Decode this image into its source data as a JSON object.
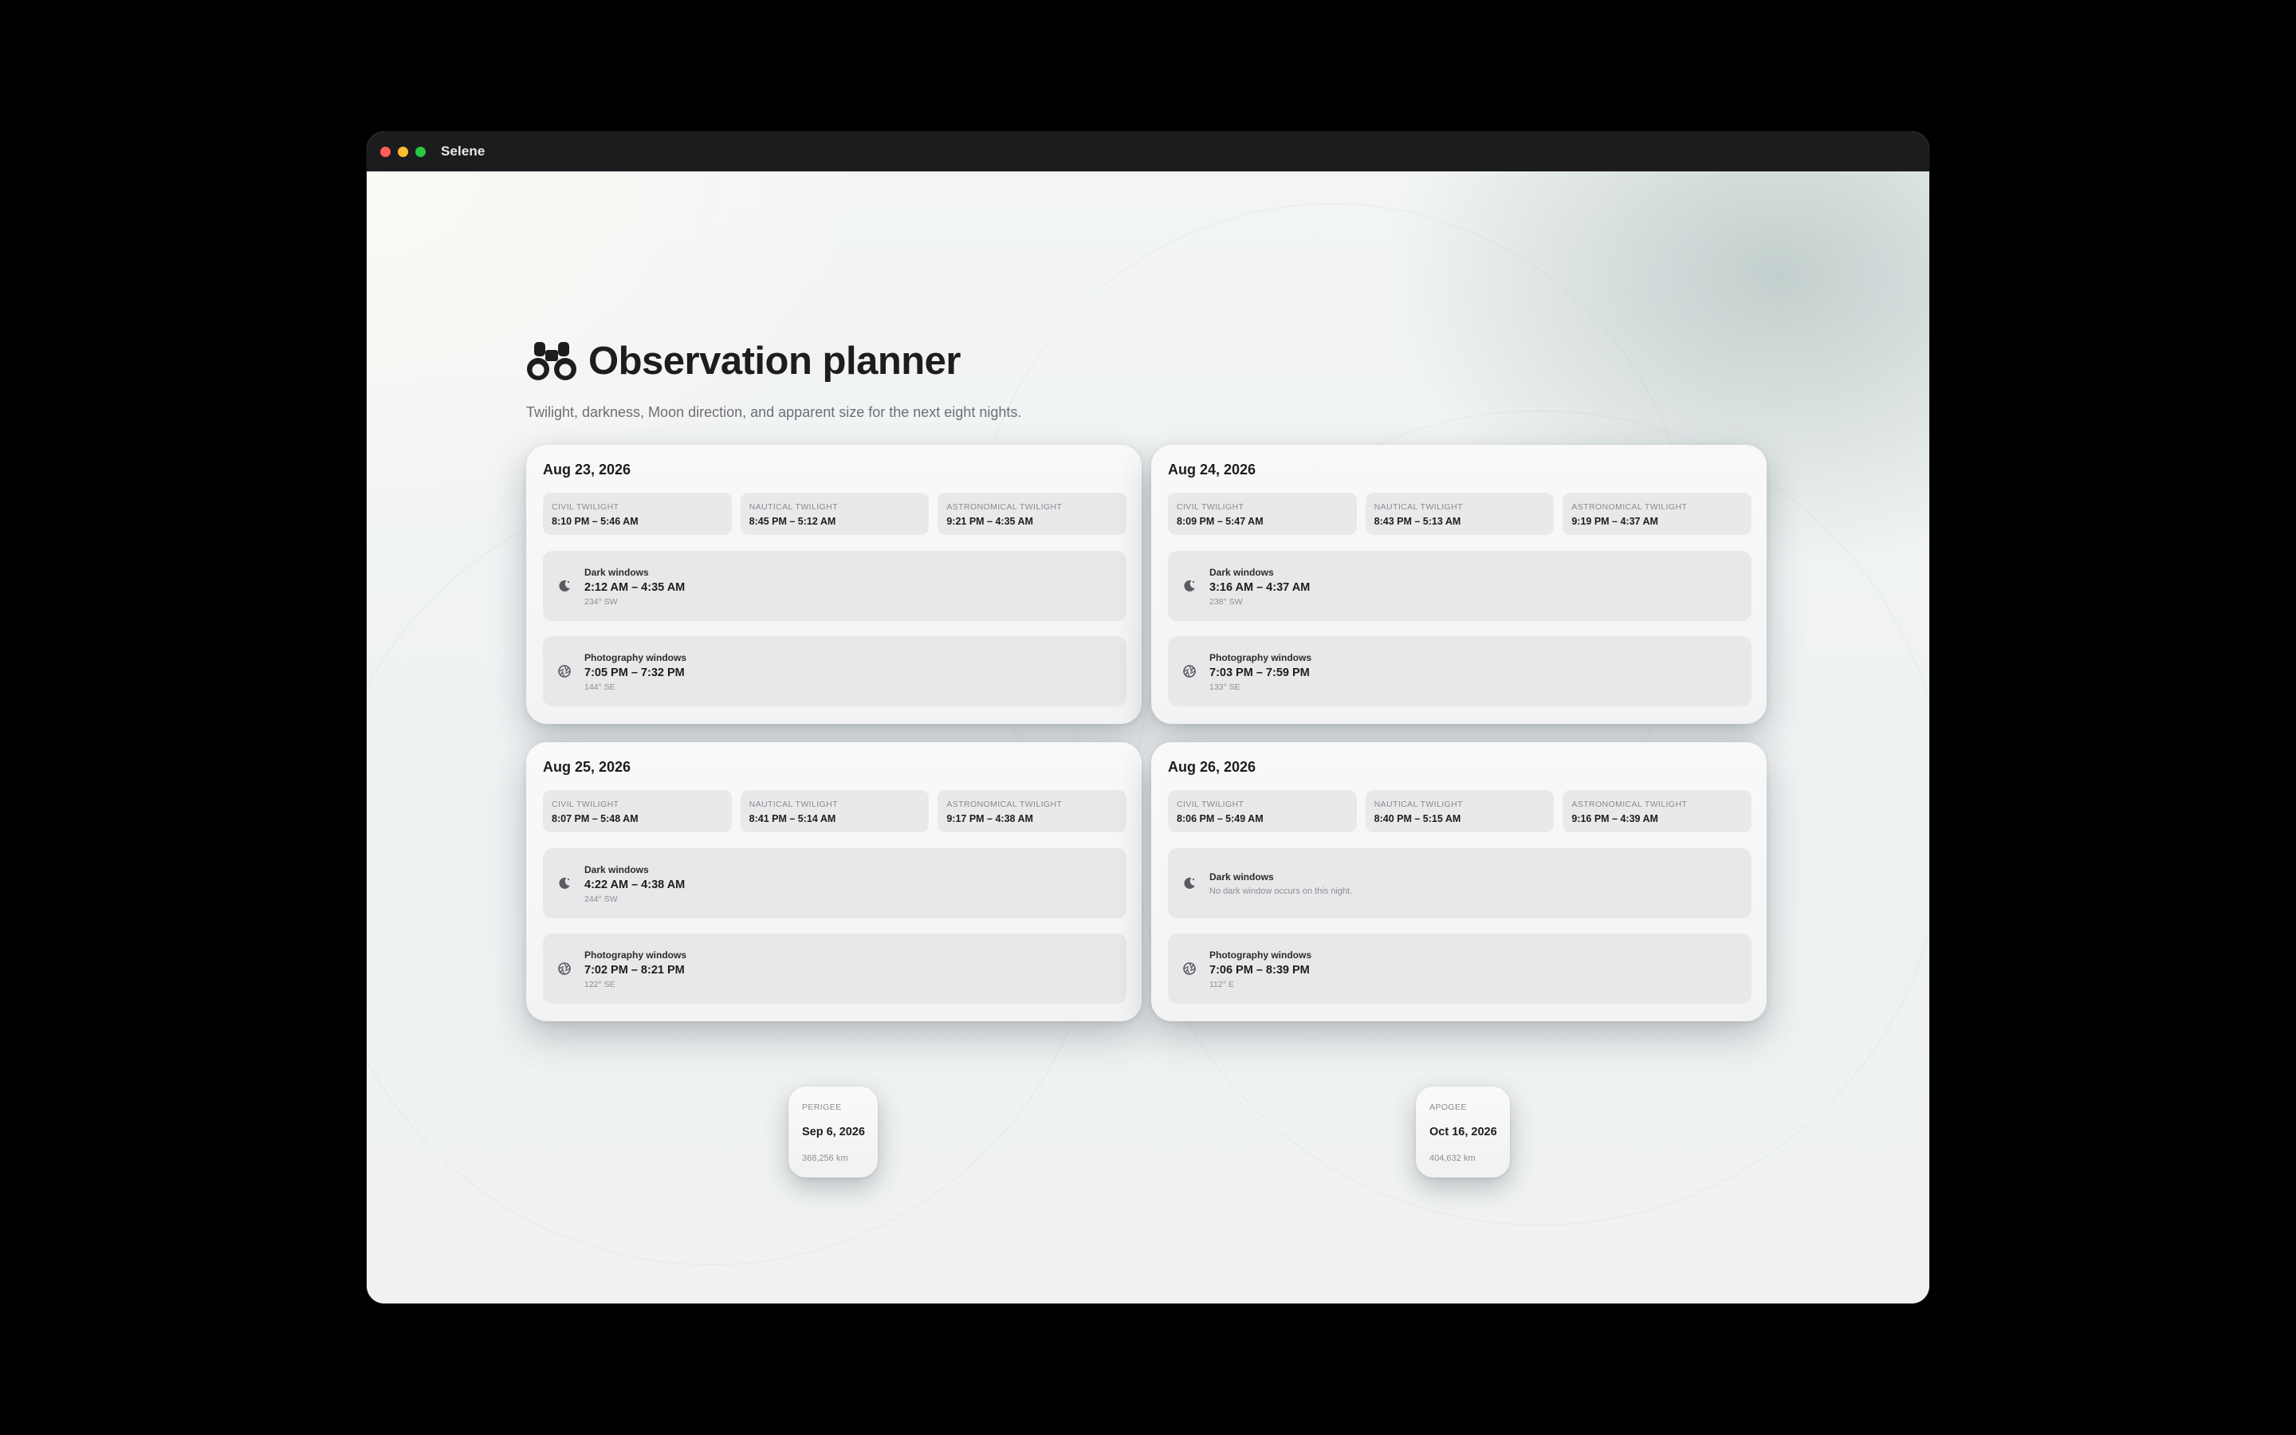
{
  "window": {
    "title": "Selene"
  },
  "page": {
    "title": "Observation planner",
    "icon": "binoculars-icon",
    "subtitle": "Twilight, darkness, Moon direction, and apparent size for the next eight nights."
  },
  "labels": {
    "civil": "CIVIL TWILIGHT",
    "nautical": "NAUTICAL TWILIGHT",
    "astronomical": "ASTRONOMICAL TWILIGHT",
    "dark_windows": "Dark windows",
    "photo_windows": "Photography windows"
  },
  "nights": [
    {
      "date": "Aug 23, 2026",
      "civil": "8:10 PM – 5:46 AM",
      "nautical": "8:45 PM – 5:12 AM",
      "astronomical": "9:21 PM – 4:35 AM",
      "dark": {
        "time": "2:12 AM – 4:35 AM",
        "direction": "234° SW"
      },
      "photo": {
        "time": "7:05 PM – 7:32 PM",
        "direction": "144° SE"
      }
    },
    {
      "date": "Aug 24, 2026",
      "civil": "8:09 PM – 5:47 AM",
      "nautical": "8:43 PM – 5:13 AM",
      "astronomical": "9:19 PM – 4:37 AM",
      "dark": {
        "time": "3:16 AM – 4:37 AM",
        "direction": "238° SW"
      },
      "photo": {
        "time": "7:03 PM – 7:59 PM",
        "direction": "133° SE"
      }
    },
    {
      "date": "Aug 25, 2026",
      "civil": "8:07 PM – 5:48 AM",
      "nautical": "8:41 PM – 5:14 AM",
      "astronomical": "9:17 PM – 4:38 AM",
      "dark": {
        "time": "4:22 AM – 4:38 AM",
        "direction": "244° SW"
      },
      "photo": {
        "time": "7:02 PM – 8:21 PM",
        "direction": "122° SE"
      }
    },
    {
      "date": "Aug 26, 2026",
      "civil": "8:06 PM – 5:49 AM",
      "nautical": "8:40 PM – 5:15 AM",
      "astronomical": "9:16 PM – 4:39 AM",
      "dark": {
        "note": "No dark window occurs on this night."
      },
      "photo": {
        "time": "7:06 PM – 8:39 PM",
        "direction": "112° E"
      }
    }
  ],
  "perigee": {
    "label": "PERIGEE",
    "date": "Sep 6, 2026",
    "distance": "368,256 km"
  },
  "apogee": {
    "label": "APOGEE",
    "date": "Oct 16, 2026",
    "distance": "404,632 km"
  }
}
